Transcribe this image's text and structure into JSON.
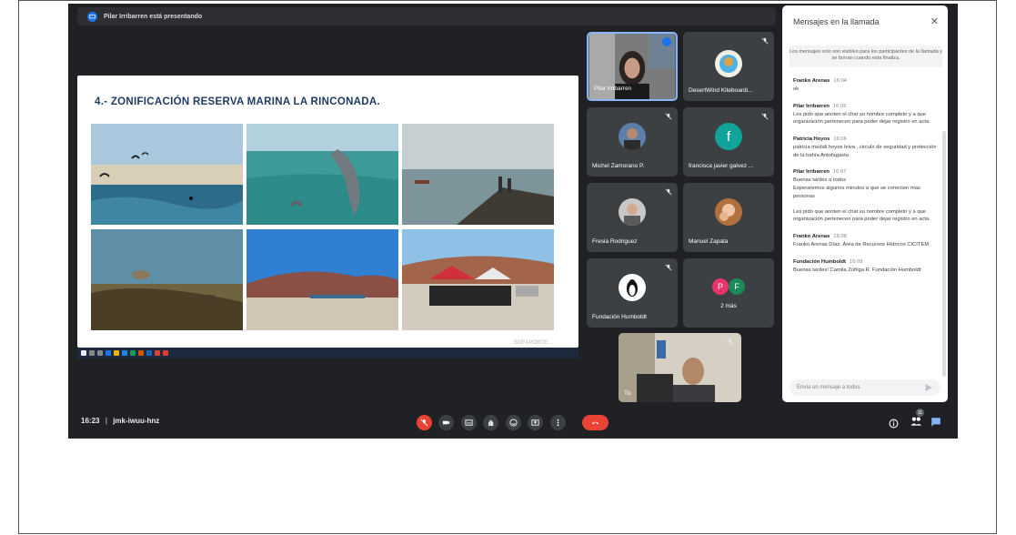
{
  "presenting": {
    "text": "Pilar Irribarren está presentando"
  },
  "slide": {
    "title": "4.- ZONIFICACIÓN RESERVA MARINA LA RINCONADA.",
    "footer": "SOFAPORTE"
  },
  "participants": [
    {
      "name": "Pilar Irribarren"
    },
    {
      "name": "DesertWind Kiteboardi..."
    },
    {
      "name": "Michel Zamorano P."
    },
    {
      "name": "francisca javier galvez ...",
      "initial": "f",
      "color": "#12a39a"
    },
    {
      "name": "Fresia Rodriguez"
    },
    {
      "name": "Manuel Zapata"
    },
    {
      "name": "Fundación Humboldt"
    },
    {
      "name": "2 más",
      "initials": [
        "P",
        "F"
      ],
      "colors": [
        "#e8346b",
        "#1b8a5a"
      ]
    }
  ],
  "self": {
    "label": "Tú"
  },
  "meeting": {
    "time": "16:23",
    "separator": "|",
    "code": "jmk-iwuu-hnz"
  },
  "people_count": "11",
  "chat": {
    "title": "Mensajes en la llamada",
    "note": "Los mensajes solo son visibles para los participantes de la llamada y se borran cuando esta finaliza.",
    "input_placeholder": "Envía un mensaje a todos",
    "messages": [
      {
        "author": "Franko Arenas",
        "time": "16:04",
        "texts": [
          "ok"
        ]
      },
      {
        "author": "Pilar Irribarren",
        "time": "16:05",
        "texts": [
          "Les pido que anoten el chat su nombre completo y a que organización pertenecen para poder dejar registro en acta"
        ]
      },
      {
        "author": "Patricia Hoyos",
        "time": "16:06",
        "texts": [
          "patricia medali hoyos leiva , circulo de seguridad y protección de la bahía Antofagasta"
        ]
      },
      {
        "author": "Pilar Irribarren",
        "time": "16:07",
        "texts": [
          "Buenas tardes a todos",
          "Esperaremos algunos minutos a que se conecten mas personas",
          "Les pido que anoten el chat su nombre completo y a que organización pertenecen para poder dejar registro en acta"
        ]
      },
      {
        "author": "Franko Arenas",
        "time": "16:08",
        "texts": [
          "Franko Arenas Díaz. Área de Recursos Hídricos CICITEM"
        ]
      },
      {
        "author": "Fundación Humboldt",
        "time": "16:09",
        "texts": [
          "Buenas tardes! Camila Zúñiga R. Fundación Humboldt"
        ]
      }
    ]
  },
  "colors": {
    "meet_bg": "#202124",
    "tile_bg": "#3c4043",
    "end_call": "#ea4335",
    "accent": "#1a73e8",
    "slide_title": "#1f3b63"
  }
}
